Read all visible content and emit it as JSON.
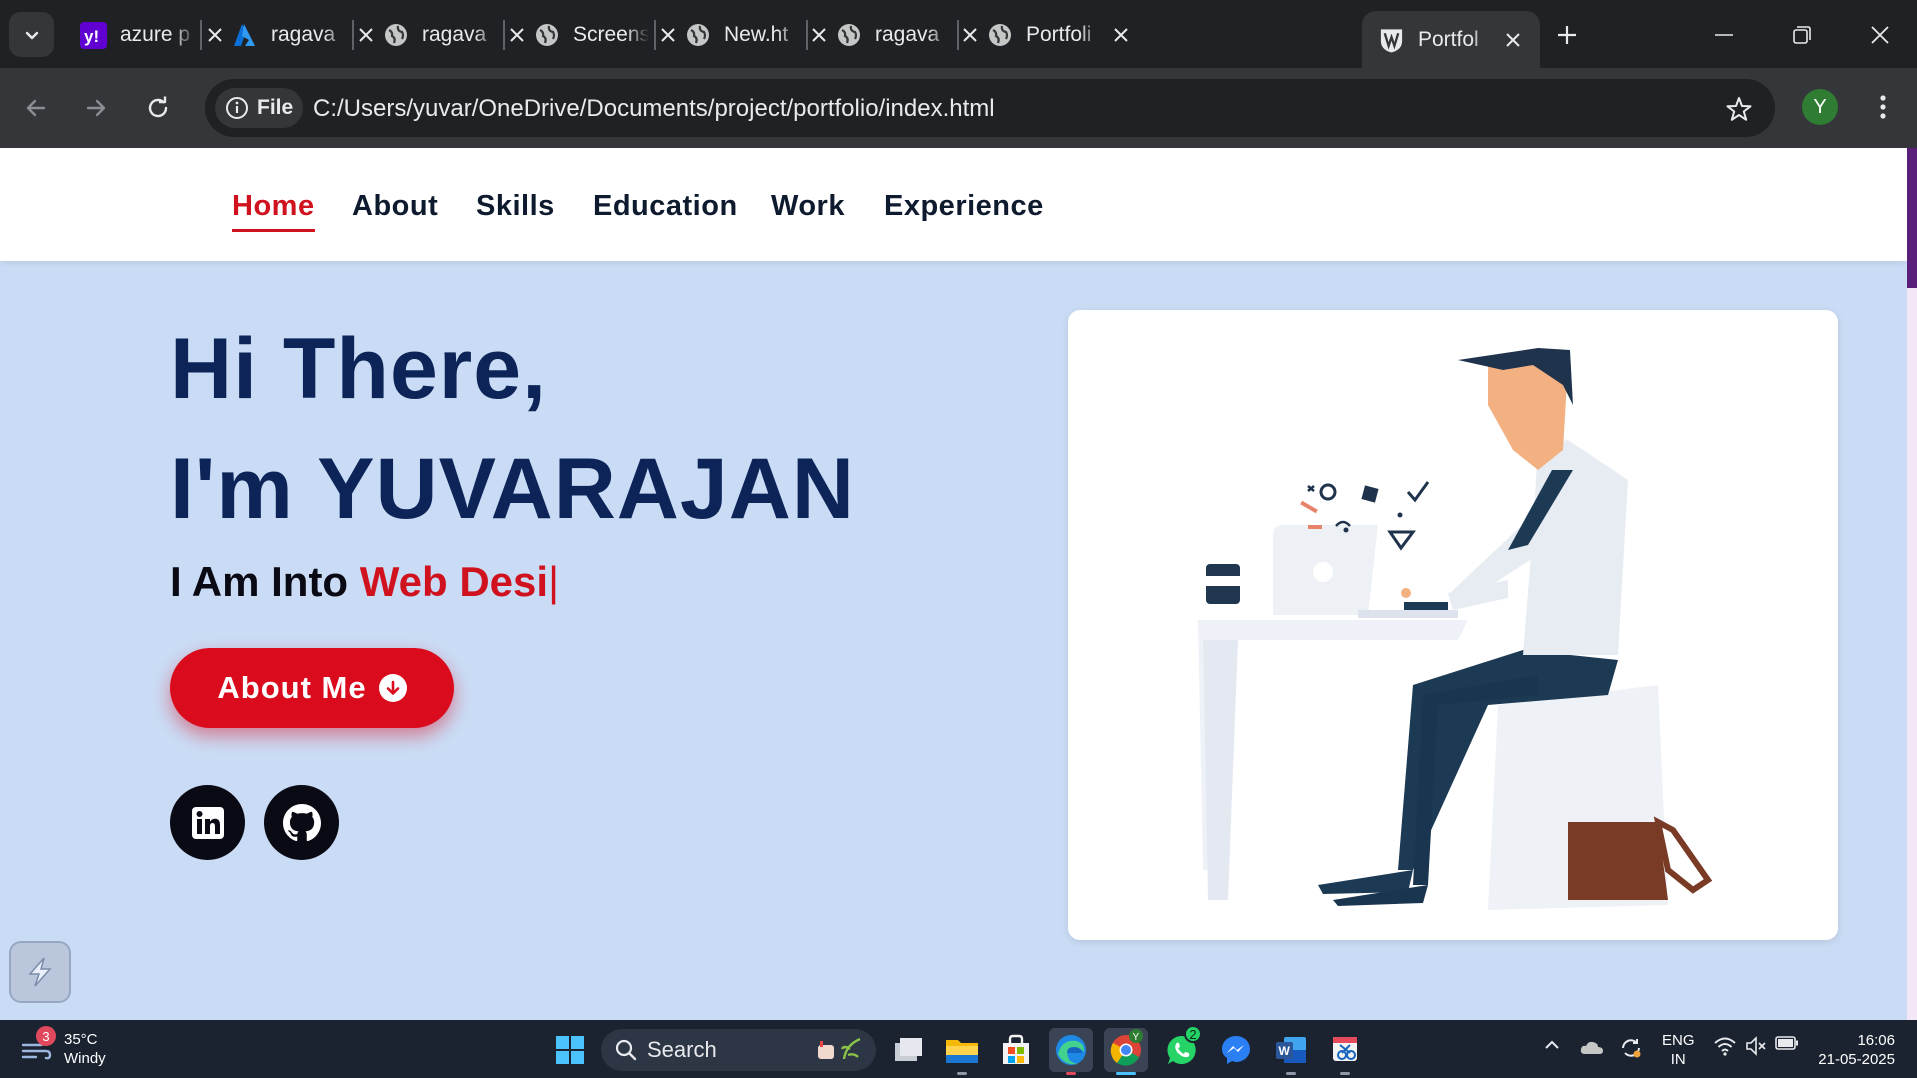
{
  "browser": {
    "tabs": [
      {
        "title": "azure p",
        "icon": "yahoo-icon"
      },
      {
        "title": "ragava",
        "icon": "azure-icon"
      },
      {
        "title": "ragava",
        "icon": "globe-icon"
      },
      {
        "title": "Screens",
        "icon": "globe-icon"
      },
      {
        "title": "New.ht",
        "icon": "globe-icon"
      },
      {
        "title": "ragava",
        "icon": "globe-icon"
      },
      {
        "title": "Portfoli",
        "icon": "globe-icon"
      },
      {
        "title": "Portfol",
        "icon": "portfolio-logo-icon",
        "active": true
      }
    ],
    "address": {
      "chip_label": "File",
      "url": "C:/Users/yuvar/OneDrive/Documents/project/portfolio/index.html"
    },
    "profile_initial": "Y"
  },
  "site": {
    "nav": [
      {
        "label": "Home",
        "active": true
      },
      {
        "label": "About"
      },
      {
        "label": "Skills"
      },
      {
        "label": "Education"
      },
      {
        "label": "Work"
      },
      {
        "label": "Experience"
      }
    ],
    "hero": {
      "line1": "Hi There,",
      "line2": "I'm YUVARAJAN",
      "sub_prefix": "I Am Into ",
      "sub_typed": "Web Desi",
      "cursor": "|",
      "button_label": "About Me",
      "social": [
        "linkedin-icon",
        "github-icon"
      ]
    },
    "colors": {
      "accent": "#d0121f",
      "heading": "#0c2458",
      "background": "#cadcf5"
    }
  },
  "taskbar": {
    "weather": {
      "badge": "3",
      "temp": "35°C",
      "condition": "Windy"
    },
    "search_label": "Search",
    "apps": [
      "file-manager-icon",
      "file-explorer-icon",
      "store-icon",
      "edge-icon",
      "chrome-icon",
      "whatsapp-icon",
      "messenger-icon",
      "word-icon",
      "snipping-tool-icon"
    ],
    "whatsapp_badge": "2",
    "chrome_badge": "Y",
    "language": {
      "line1": "ENG",
      "line2": "IN"
    },
    "clock": {
      "time": "16:06",
      "date": "21-05-2025"
    }
  }
}
